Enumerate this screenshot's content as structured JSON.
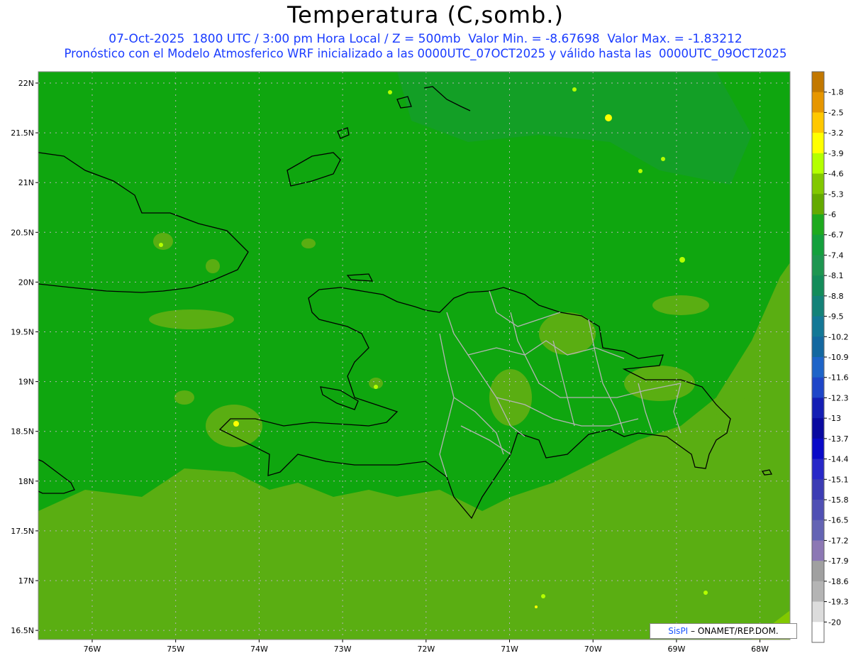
{
  "header": {
    "title": "Temperatura (C,somb.)",
    "date": "07-Oct-2025",
    "time_utc": "1800 UTC",
    "local_time": "3:00 pm Hora Local",
    "level": "Z = 500mb",
    "min_value": "Valor Min. = -8.67698",
    "max_value": "Valor Max. = -1.83212",
    "forecast_desc": "Pronóstico con el Modelo Atmosferico WRF inicializado a las 0000UTC_07OCT2025 y válido hasta las  0000UTC_09OCT2025"
  },
  "map": {
    "lat_labels": [
      "22N",
      "21.5N",
      "21N",
      "20.5N",
      "20N",
      "19.5N",
      "19N",
      "18.5N",
      "18N",
      "17.5N",
      "17N",
      "16.5N"
    ],
    "lat_values": [
      22,
      21.5,
      21,
      20.5,
      20,
      19.5,
      19,
      18.5,
      18,
      17.5,
      17,
      16.5
    ],
    "lon_labels": [
      "76W",
      "75W",
      "74W",
      "73W",
      "72W",
      "71W",
      "70W",
      "69W",
      "68W"
    ],
    "lon_values": [
      -76,
      -75,
      -74,
      -73,
      -72,
      -71,
      -70,
      -69,
      -68
    ],
    "colors": {
      "base": "#0fa60f",
      "warm": "#5aae12",
      "cool": "#17993a",
      "coast": "#000000",
      "provinces": "#b4b4b4"
    }
  },
  "colorbar": {
    "labels": [
      "-1.8",
      "-2.5",
      "-3.2",
      "-3.9",
      "-4.6",
      "-5.3",
      "-6",
      "-6.7",
      "-7.4",
      "-8.1",
      "-8.8",
      "-9.5",
      "-10.2",
      "-10.9",
      "-11.6",
      "-12.3",
      "-13",
      "-13.7",
      "-14.4",
      "-15.1",
      "-15.8",
      "-16.5",
      "-17.2",
      "-17.9",
      "-18.6",
      "-19.3",
      "-20"
    ],
    "colors": [
      "#c27800",
      "#e69600",
      "#ffc800",
      "#ffff00",
      "#b4ff00",
      "#82c800",
      "#64aa00",
      "#1eaa1e",
      "#14a03c",
      "#1e9650",
      "#148c5a",
      "#148278",
      "#147896",
      "#1468a0",
      "#1e64c8",
      "#1e46c8",
      "#141eb4",
      "#0a0aa0",
      "#0a0ac8",
      "#2828c8",
      "#3c3cb4",
      "#5050b4",
      "#6464b4",
      "#8c78b4",
      "#a0a0a0",
      "#b4b4b4",
      "#dcdcdc",
      "#ffffff"
    ]
  },
  "credit": {
    "brand": "SisPI",
    "text": " – ONAMET/REP.DOM."
  }
}
